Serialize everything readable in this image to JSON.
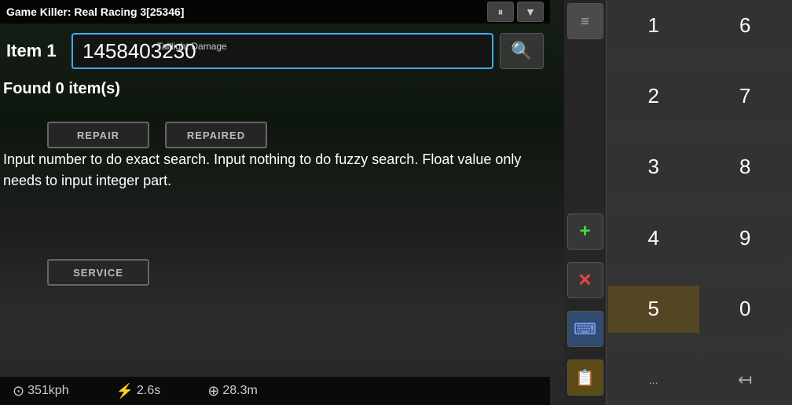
{
  "title": "Game Killer: Real Racing 3[25346]",
  "titleControls": {
    "pause": "⏸",
    "dropdown": "▼"
  },
  "searchRow": {
    "itemLabel": "Item 1",
    "inputValue": "1458403230",
    "searchIcon": "🔍"
  },
  "taillightLabel": "Taillight Damage",
  "foundText": "Found 0 item(s)",
  "instructions": "Input number to do exact search. Input nothing to do fuzzy search. Float value only needs to input integer part.",
  "repairBtn": "REPAIR",
  "repairedBtn": "REPAIRED",
  "serviceBtn": "SERVICE",
  "statusBar": {
    "speed": "351kph",
    "time": "2.6s",
    "distance": "28.3m"
  },
  "toolbar": {
    "listIcon": "≡",
    "addIcon": "+",
    "deleteIcon": "✕",
    "keyboardIcon": "⌨",
    "filesIcon": "📋"
  },
  "numpad": {
    "buttons": [
      "1",
      "6",
      "2",
      "7",
      "3",
      "8",
      "4",
      "9",
      "5",
      "0"
    ],
    "extras": [
      "...",
      "↤"
    ]
  },
  "colors": {
    "accent": "#44aaff",
    "green": "#44dd44",
    "red": "#ee4444",
    "amber": "#ffaa22"
  }
}
